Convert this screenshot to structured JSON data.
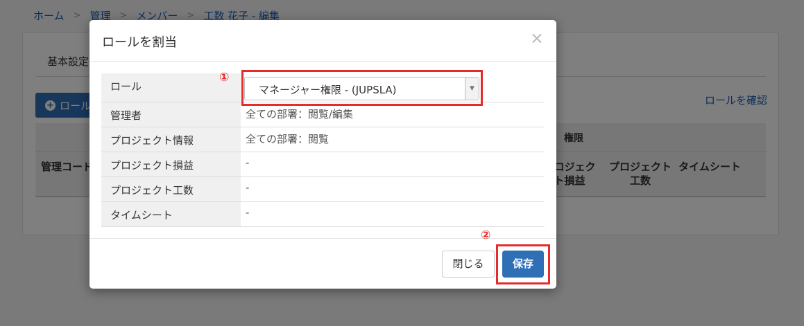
{
  "breadcrumb": [
    "ホーム",
    "管理",
    "メンバー",
    "工数 花子 - 編集"
  ],
  "breadcrumb_separator": ">",
  "tabs": {
    "basic": "基本設定"
  },
  "toolbar": {
    "add_role": "ロール",
    "confirm_role": "ロールを確認"
  },
  "table": {
    "permission_header": "権限",
    "columns": {
      "management_code": "管理コード",
      "project_profit": "プロジェクト損益",
      "project_hours": "プロジェクト工数",
      "timesheet": "タイムシート"
    }
  },
  "modal": {
    "title": "ロールを割当",
    "close": "×",
    "rows": [
      {
        "label": "ロール",
        "value": "マネージャー権限 - (JUPSLA)"
      },
      {
        "label": "管理者",
        "value": "全ての部署：閲覧/編集"
      },
      {
        "label": "プロジェクト情報",
        "value": "全ての部署：閲覧"
      },
      {
        "label": "プロジェクト損益",
        "value": "-"
      },
      {
        "label": "プロジェクト工数",
        "value": "-"
      },
      {
        "label": "タイムシート",
        "value": "-"
      }
    ],
    "buttons": {
      "close": "閉じる",
      "save": "保存"
    }
  },
  "annotations": {
    "marker1": "①",
    "marker2": "②"
  },
  "colors": {
    "primary": "#2f6fb6",
    "highlight": "#e52b2b",
    "link": "#1a5db7"
  }
}
